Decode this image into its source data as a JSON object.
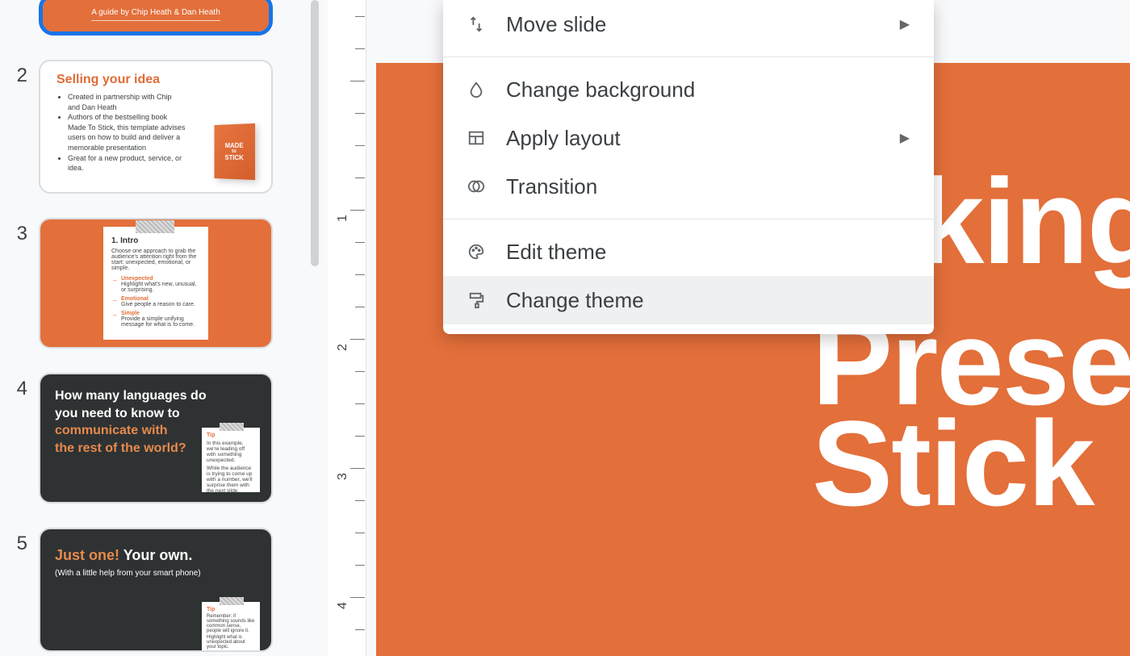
{
  "colors": {
    "accent": "#e36f3a",
    "dark": "#2f3233",
    "selection": "#1a73e8"
  },
  "slides": {
    "1": {
      "subtitle": "A guide by Chip Heath & Dan Heath"
    },
    "2": {
      "number": "2",
      "title": "Selling your idea",
      "bullets": [
        "Created in partnership with Chip and Dan Heath",
        "Authors of the bestselling book Made To Stick, this template advises users on how to build and deliver a memorable presentation",
        "Great for a new product, service, or idea."
      ],
      "book_title_1": "MADE",
      "book_title_2": "to",
      "book_title_3": "STICK"
    },
    "3": {
      "number": "3",
      "heading": "1. Intro",
      "lead": "Choose one approach to grab the audience's attention right from the start: unexpected, emotional, or simple.",
      "items": [
        {
          "k": "Unexpected",
          "v": "Highlight what's new, unusual, or surprising."
        },
        {
          "k": "Emotional",
          "v": "Give people a reason to care."
        },
        {
          "k": "Simple",
          "v": "Provide a simple unifying message for what is to come."
        }
      ]
    },
    "4": {
      "number": "4",
      "line1": "How many languages do",
      "line2": "you need to know to",
      "line3": "communicate with",
      "line4": "the rest of the world?",
      "tip_h": "Tip",
      "tip_a": "In this example, we're leading off with something unexpected.",
      "tip_b": "While the audience is trying to come up with a number, we'll surprise them with the next slide."
    },
    "5": {
      "number": "5",
      "title_a": "Just one!",
      "title_b": " Your own.",
      "sub": "(With a little help from your smart phone)",
      "tip_h": "Tip",
      "tip_a": "Remember: if something sounds like common sense, people will ignore it.",
      "tip_b": "Highlight what is unexpected about your topic."
    }
  },
  "ruler": {
    "labels": [
      "1",
      "2",
      "3",
      "4"
    ]
  },
  "canvas": {
    "line1": "king",
    "line2": "Present",
    "line3": "Stick"
  },
  "menu": {
    "move_slide": "Move slide",
    "change_background": "Change background",
    "apply_layout": "Apply layout",
    "transition": "Transition",
    "edit_theme": "Edit theme",
    "change_theme": "Change theme"
  }
}
